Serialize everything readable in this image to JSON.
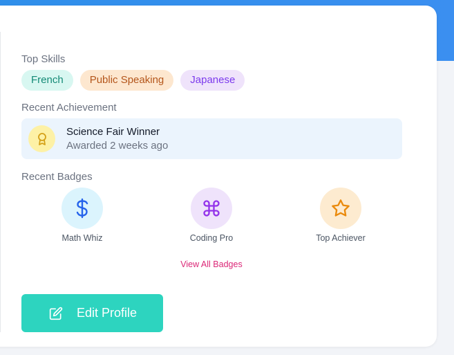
{
  "skills": {
    "heading": "Top Skills",
    "items": [
      {
        "label": "French"
      },
      {
        "label": "Public Speaking"
      },
      {
        "label": "Japanese"
      }
    ]
  },
  "achievement": {
    "heading": "Recent Achievement",
    "icon": "award-ribbon-icon",
    "title": "Science Fair Winner",
    "subtitle": "Awarded 2 weeks ago",
    "icon_bg": "#fdf1a6",
    "icon_color": "#d4a017"
  },
  "badges": {
    "heading": "Recent Badges",
    "items": [
      {
        "label": "Math Whiz",
        "icon": "dollar-icon",
        "bg": "#dbf4fd",
        "color": "#2563eb"
      },
      {
        "label": "Coding Pro",
        "icon": "command-icon",
        "bg": "#efe3fb",
        "color": "#9333ea"
      },
      {
        "label": "Top Achiever",
        "icon": "star-icon",
        "bg": "#fdebd0",
        "color": "#ea8a0c"
      }
    ],
    "view_all": "View All Badges"
  },
  "actions": {
    "edit_profile": "Edit Profile",
    "edit_icon": "edit-icon"
  },
  "colors": {
    "accent": "#2dd4bf",
    "banner": "#2f8fea",
    "link": "#db2777"
  }
}
